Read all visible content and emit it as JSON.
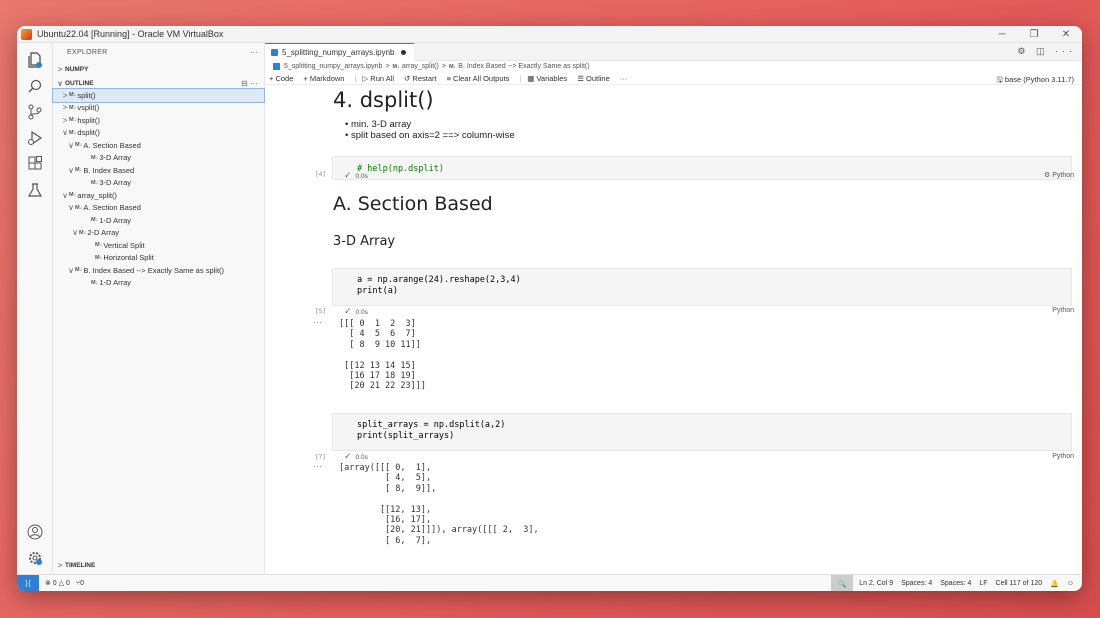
{
  "window": {
    "title": "Ubuntu22.04 [Running] - Oracle VM VirtualBox"
  },
  "sidebar": {
    "header": "EXPLORER",
    "more": "···",
    "sections": {
      "numpy": "NUMPY",
      "outline": "OUTLINE",
      "timeline": "TIMELINE"
    },
    "outline": [
      {
        "label": "split()",
        "chev": ">",
        "md": "M↓"
      },
      {
        "label": "vsplit()",
        "chev": ">",
        "md": "M↓"
      },
      {
        "label": "hsplit()",
        "chev": ">",
        "md": "M↓"
      },
      {
        "label": "dsplit()",
        "chev": "∨",
        "md": "M↓"
      },
      {
        "label": "A. Section Based",
        "chev": "∨",
        "md": "M↓"
      },
      {
        "label": "3-D Array",
        "chev": "",
        "md": "M↓"
      },
      {
        "label": "B. Index Based",
        "chev": "∨",
        "md": "M↓"
      },
      {
        "label": "3-D Array",
        "chev": "",
        "md": "M↓"
      },
      {
        "label": "array_split()",
        "chev": "∨",
        "md": "M↓"
      },
      {
        "label": "A. Section Based",
        "chev": "∨",
        "md": "M↓"
      },
      {
        "label": "1-D Array",
        "chev": "",
        "md": "M↓"
      },
      {
        "label": "2-D Array",
        "chev": "∨",
        "md": "M↓"
      },
      {
        "label": "Vertical Split",
        "chev": "",
        "md": "M↓"
      },
      {
        "label": "Horizontal Split",
        "chev": "",
        "md": "M↓"
      },
      {
        "label": "B. Index Based --> Exactly Same as split()",
        "chev": "∨",
        "md": "M↓"
      },
      {
        "label": "1-D Array",
        "chev": "",
        "md": "M↓"
      }
    ]
  },
  "editor": {
    "tab": "5_splitting_numpy_arrays.ipynb",
    "breadcrumb": [
      "5_splitting_numpy_arrays.ipynb",
      "array_split()",
      "B. Index Based --> Exactly Same as split()"
    ],
    "toolbar": [
      "+ Code",
      "+ Markdown",
      "▷ Run All",
      "↺ Restart",
      "≡ Clear All Outputs",
      "▦ Variables",
      "☰ Outline",
      "···"
    ],
    "kernel": "base (Python 3.11.7)"
  },
  "notebook": {
    "h_dsplit": "4. dsplit()",
    "bullets": [
      "min. 3-D array",
      "split based on axis=2 ==> column-wise"
    ],
    "cell4": {
      "num": "[4]",
      "code": "# help(np.dsplit)",
      "time": "0.0s",
      "lang": "Python"
    },
    "h_section": "A. Section Based",
    "h_3d": "3-D Array",
    "cell5": {
      "num": "[5]",
      "code1": "a = np.arange(24).reshape(2,3,4)",
      "code2": "print(a)",
      "time": "0.0s",
      "lang": "Python",
      "output": "[[[ 0  1  2  3]\n  [ 4  5  6  7]\n  [ 8  9 10 11]]\n\n [[12 13 14 15]\n  [16 17 18 19]\n  [20 21 22 23]]]"
    },
    "cell7": {
      "num": "[7]",
      "code1": "split_arrays = np.dsplit(a,2)",
      "code2": "print(split_arrays)",
      "time": "0.0s",
      "lang": "Python",
      "output": "[array([[[ 0,  1],\n         [ 4,  5],\n         [ 8,  9]],\n\n        [[12, 13],\n         [16, 17],\n         [20, 21]]]), array([[[ 2,  3],\n         [ 6,  7],"
    },
    "ellipsis": "···"
  },
  "statusbar": {
    "left": [
      "⊗ 0 △ 0",
      "⑂0"
    ],
    "position": "Ln 2, Col 9",
    "spaces1": "Spaces: 4",
    "spaces2": "Spaces: 4",
    "eol": "LF",
    "cell": "Cell 117 of 120"
  }
}
